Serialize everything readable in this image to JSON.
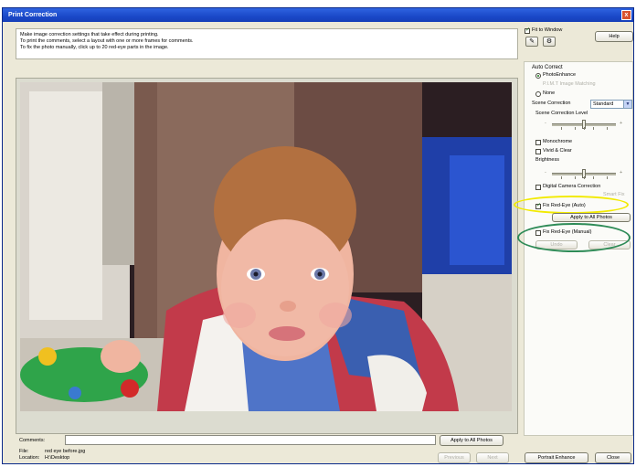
{
  "window": {
    "title": "Print Correction",
    "close_glyph": "x"
  },
  "instructions": [
    "Make image correction settings that take effect during printing.",
    "To print the comments, select a layout with one or more frames for comments.",
    "To fix the photo manually, click up to 20 red-eye parts in the image."
  ],
  "toolbar": {
    "fit_to_window_label": "Fit to Window",
    "fit_to_window_checked": true,
    "help_label": "Help"
  },
  "auto_correct": {
    "heading": "Auto Correct",
    "options": [
      {
        "label": "PhotoEnhance",
        "selected": true,
        "enabled": true
      },
      {
        "label": "P.I.M.T Image Matching",
        "selected": false,
        "enabled": false
      },
      {
        "label": "None",
        "selected": false,
        "enabled": true
      }
    ]
  },
  "scene_correction": {
    "label": "Scene Correction",
    "value": "Standard",
    "level_label": "Scene Correction Level",
    "level_fraction": 0.5
  },
  "checks": {
    "monochrome": {
      "label": "Monochrome",
      "checked": false
    },
    "vivid_clear": {
      "label": "Vivid & Clear",
      "checked": false
    },
    "brightness_label": "Brightness",
    "brightness_fraction": 0.5,
    "digital_camera": {
      "label": "Digital Camera Correction",
      "checked": false
    },
    "digital_camera_sub": "Smart Fix",
    "fix_red_eye_auto": {
      "label": "Fix Red-Eye (Auto)",
      "checked": true
    },
    "apply_all_label": "Apply to All Photos",
    "fix_red_eye_manual": {
      "label": "Fix Red-Eye (Manual)",
      "checked": false
    },
    "undo_label": "Undo",
    "clear_label": "Clear"
  },
  "highlight_colors": {
    "auto": "#f2ea00",
    "manual": "#2e8b57"
  },
  "comments": {
    "label": "Comments:",
    "value": "",
    "apply_all_label": "Apply to All Photos"
  },
  "file_info": {
    "file_label": "File:",
    "file_value": "red eye before.jpg",
    "location_label": "Location:",
    "location_value": "H:\\Desktop"
  },
  "nav": {
    "previous_label": "Previous",
    "next_label": "Next"
  },
  "footer": {
    "portrait_label": "Portrait Enhance",
    "close_label": "Close"
  }
}
